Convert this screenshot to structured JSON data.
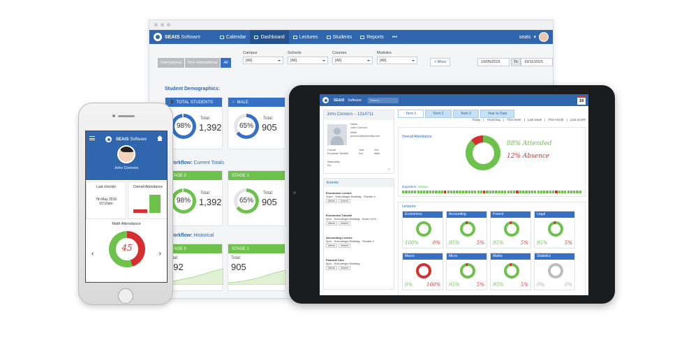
{
  "desktop": {
    "brand": "SEAtS",
    "brand_sub": "Software",
    "nav": [
      {
        "label": "Calendar",
        "icon": "calendar-icon"
      },
      {
        "label": "Dashboard",
        "icon": "dashboard-icon"
      },
      {
        "label": "Lectures",
        "icon": "lectures-icon"
      },
      {
        "label": "Students",
        "icon": "students-icon"
      },
      {
        "label": "Reports",
        "icon": "reports-icon"
      },
      {
        "label": "•••",
        "icon": "more-icon"
      }
    ],
    "active_nav": "Dashboard",
    "user": "seats",
    "segment": [
      "International",
      "Non-International",
      "All"
    ],
    "segment_selected": "All",
    "filters": [
      {
        "label": "Campus",
        "value": "[All]"
      },
      {
        "label": "Schools",
        "value": "[All]"
      },
      {
        "label": "Courses",
        "value": "[All]"
      },
      {
        "label": "Modules",
        "value": "[All]"
      }
    ],
    "more_label": "+ More",
    "date_from": "19/05/2015",
    "to_label": "To",
    "date_to": "19/11/2015",
    "sections": {
      "demographics": "Student Demographics:",
      "workflow_current_a": "/I Workflow:",
      "workflow_current_b": "Current Totals",
      "workflow_hist_a": "/I Workflow:",
      "workflow_hist_b": "Historical"
    },
    "cards": {
      "total_students": {
        "title": "TOTAL STUDENTS",
        "percent": "98%",
        "total_label": "Total:",
        "total": "1,392",
        "fraction": 0.98
      },
      "male": {
        "title": "MALE",
        "percent": "65%",
        "total_label": "Total:",
        "total": "905",
        "fraction": 0.65
      },
      "stage0_cur": {
        "title": "STAGE 0",
        "percent": "98%",
        "total_label": "Total:",
        "total": "1,392",
        "fraction": 0.98
      },
      "stage1_cur": {
        "title": "STAGE 1",
        "percent": "65%",
        "total_label": "Total:",
        "total": "905",
        "fraction": 0.65
      },
      "stage0_hist": {
        "title": "STAGE 0",
        "total_label": "Total:",
        "total": "392"
      },
      "stage1_hist": {
        "title": "STAGE 1",
        "total_label": "Total:",
        "total": "905"
      }
    },
    "colors": {
      "primary": "#2f66ad",
      "accent": "#3570c4",
      "green": "#6cc24a",
      "ring_bg": "#e3e5e8"
    }
  },
  "phone": {
    "brand": "SEAtS",
    "brand_sub": "Software",
    "student_name": "John Connors",
    "last_checkin_label": "Last checkin",
    "last_checkin_date": "7th May 2016",
    "last_checkin_time": "10:10am",
    "overall_label": "Overall Attendance",
    "math_label": "Math Attendance",
    "math_value": "45",
    "math_fraction": 0.45,
    "prev": "‹",
    "next": "›"
  },
  "tablet": {
    "brand": "SEAtS",
    "brand_sub": "Software",
    "search_placeholder": "Search...",
    "calendar_day": "16",
    "student": {
      "name": "John Connors",
      "id": "1314711",
      "name_label": "Name",
      "name_value": "John Connors",
      "email_label": "eMail",
      "email_value": "jconnors@university.com",
      "course_label": "Course",
      "course_value": "European Studies",
      "year_label": "Year",
      "year_value": "2nd",
      "sex_label": "Sex",
      "sex_value": "Male",
      "nationality_label": "Nationality",
      "nationality_value": "EU"
    },
    "events_title": "Events",
    "events": [
      {
        "title": "Economics Lecture",
        "detail": "11am - Schrodinger Building - Theatre 4"
      },
      {
        "title": "Economics Tutorial",
        "detail": "2pm - Schrodinger Building - Room 1101"
      },
      {
        "title": "Accounting Lecture",
        "detail": "3pm - Schrodinger Building - Theatre 2"
      },
      {
        "title": "Pastoral Care",
        "detail": "5pm - Schrodinger Building"
      }
    ],
    "attend_label": "Attend",
    "absent_label": "Absent",
    "tabs": [
      "Term 1",
      "Term 2",
      "Term 3",
      "Year to Date"
    ],
    "tab_selected": "Term 1",
    "ranges": [
      "Today",
      "Yesterday",
      "This week",
      "Last week",
      "This month",
      "Last month"
    ],
    "overall_title": "Overall Attendance:",
    "attended_text": "88% Attended",
    "absence_text": "12% Absence",
    "attended_fraction": 0.88,
    "days_label": "Days/term:",
    "days_value": "85days",
    "lectures_title": "Lectures:",
    "lectures": [
      {
        "name": "Economics",
        "a": "100",
        "b": "0",
        "fraction": 1.0
      },
      {
        "name": "Accounting",
        "a": "95",
        "b": "5",
        "fraction": 0.95
      },
      {
        "name": "French",
        "a": "95",
        "b": "5",
        "fraction": 0.95
      },
      {
        "name": "Legal",
        "a": "95",
        "b": "5",
        "fraction": 0.95
      },
      {
        "name": "Macro",
        "a": "0",
        "b": "100",
        "fraction": 0.0
      },
      {
        "name": "Micro",
        "a": "95",
        "b": "5",
        "fraction": 0.95
      },
      {
        "name": "Maths",
        "a": "95",
        "b": "5",
        "fraction": 0.95
      },
      {
        "name": "Statistics",
        "a": "0",
        "b": "0",
        "fraction": -1
      }
    ]
  }
}
